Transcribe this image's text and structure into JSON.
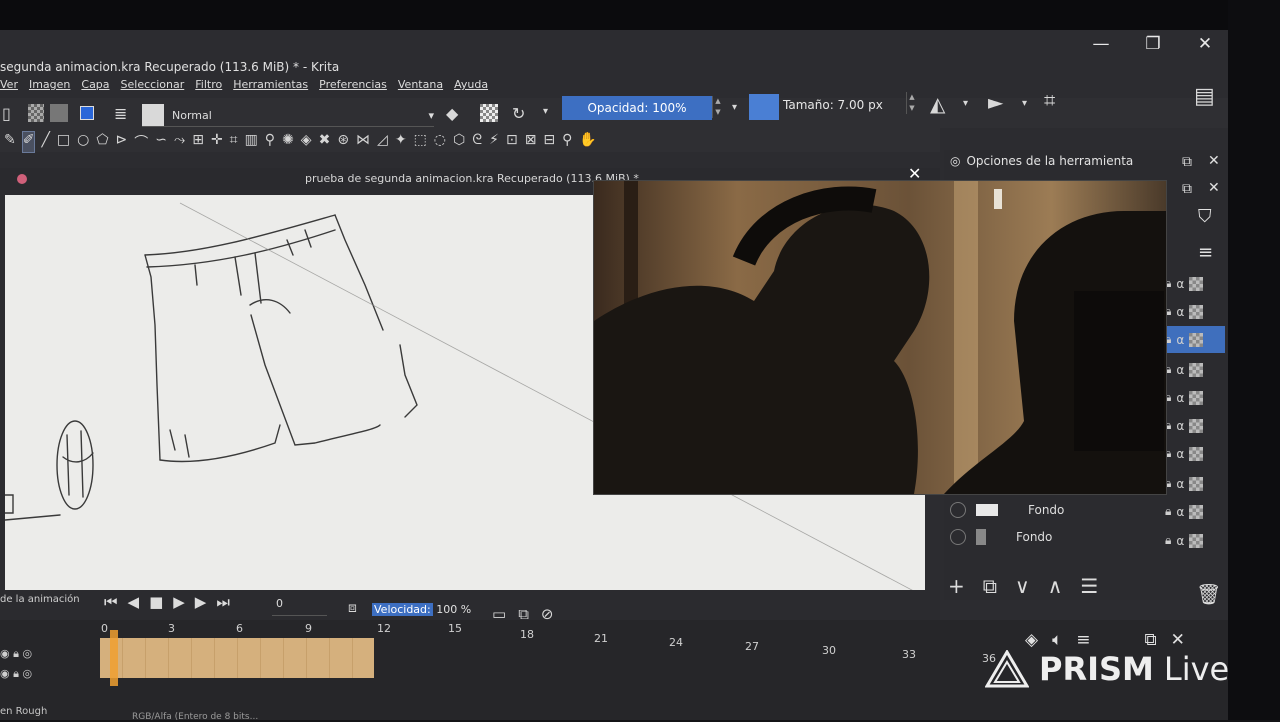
{
  "window": {
    "title": "segunda animacion.kra Recuperado (113.6 MiB) * - Krita",
    "minimize": "—",
    "maximize": "❐",
    "close": "✕"
  },
  "menubar": [
    "Ver",
    "Imagen",
    "Capa",
    "Seleccionar",
    "Filtro",
    "Herramientas",
    "Preferencias",
    "Ventana",
    "Ayuda"
  ],
  "toolbar": {
    "blend_mode": "Normal",
    "opacity_label": "Opacidad: 100%",
    "size_label": "Tamaño: 7.00 px",
    "accent_color": "#3d6fc2"
  },
  "document": {
    "tab_title": "prueba de segunda animacion.kra Recuperado (113.6 MiB) *"
  },
  "tool_options": {
    "title": "Opciones de la herramienta"
  },
  "layers": {
    "items": [
      {
        "name": "Fondo"
      },
      {
        "name": "Fondo"
      }
    ]
  },
  "animation": {
    "panel_label": "de la animación",
    "current_frame": "0",
    "speed_label": "Velocidad:",
    "speed_value": "100 %",
    "ruler": [
      "0",
      "3",
      "6",
      "9",
      "12",
      "15",
      "18",
      "21",
      "24",
      "27",
      "30",
      "33",
      "36"
    ]
  },
  "status": {
    "brush": "en Rough",
    "color_info": "RGB/Alfa (Entero de 8 bits..."
  },
  "overlay": {
    "watermark_brand": "PRISM",
    "watermark_suffix": "Live"
  }
}
